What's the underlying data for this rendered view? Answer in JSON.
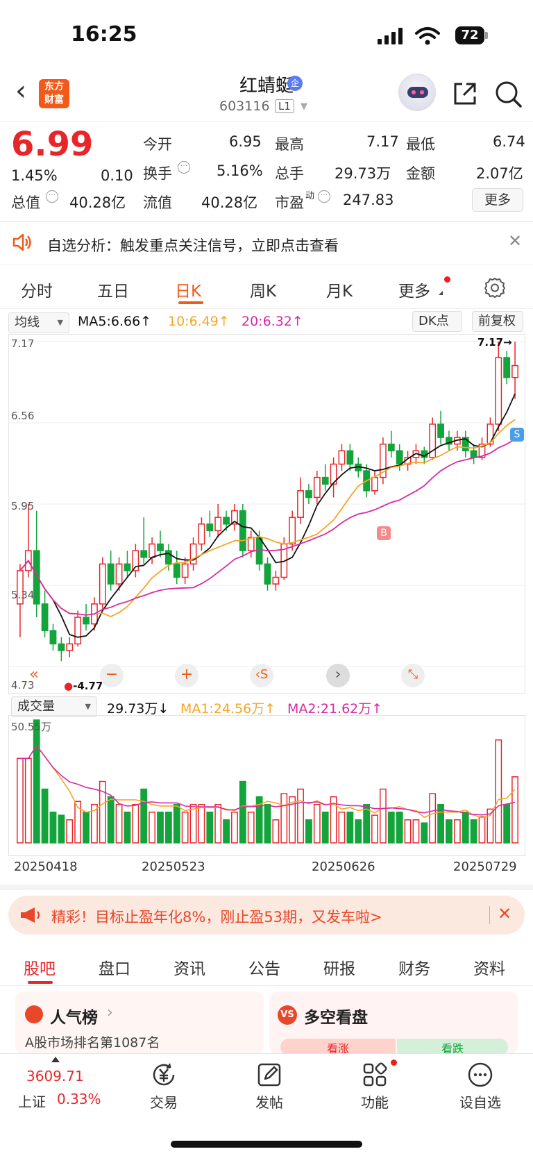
{
  "status": {
    "time": "16:25",
    "battery": "72"
  },
  "header": {
    "logo": "东方财富",
    "name": "红蜻蜓",
    "badge": "企",
    "code": "603116",
    "level": "L1"
  },
  "quote": {
    "price": "6.99",
    "change_pct": "1.45%",
    "change": "0.10",
    "open_label": "今开",
    "open": "6.95",
    "high_label": "最高",
    "high": "7.17",
    "low_label": "最低",
    "low": "6.74",
    "turnover_label": "换手",
    "turnover": "5.16%",
    "volume_label": "总手",
    "volume": "29.73万",
    "amount_label": "金额",
    "amount": "2.07亿",
    "mcap_label": "总值",
    "mcap": "40.28亿",
    "float_label": "流值",
    "float": "40.28亿",
    "pe_label": "市盈",
    "pe_sup": "动",
    "pe": "247.83",
    "more": "更多"
  },
  "alert": {
    "text": "自选分析：触发重点关注信号，立即点击查看"
  },
  "tabs": [
    "分时",
    "五日",
    "日K",
    "周K",
    "月K",
    "更多"
  ],
  "active_tab": "日K",
  "ma_bar": {
    "selector": "均线",
    "ma5": "MA5:6.66",
    "ma10": "10:6.49",
    "ma20": "20:6.32",
    "dk": "DK点",
    "fq": "前复权"
  },
  "vol_bar": {
    "selector": "成交量",
    "vol": "29.73万",
    "ma1": "MA1:24.56万",
    "ma2": "MA2:21.62万",
    "max_label": "50.55万"
  },
  "colors": {
    "up": "#e8262a",
    "down": "#13a43b",
    "ma5": "#111111",
    "ma10": "#f5a623",
    "ma20": "#d62aa6",
    "accent": "#f05a1a"
  },
  "chart_data": {
    "type": "candlestick",
    "y_ticks": [
      "7.17",
      "6.56",
      "5.95",
      "5.34",
      "4.73"
    ],
    "ylim": [
      4.73,
      7.17
    ],
    "max_label": "7.17",
    "min_label": "4.77",
    "x_ticks": [
      "20250418",
      "20250523",
      "20250626",
      "20250729"
    ],
    "markers": [
      "B",
      "S"
    ],
    "ohlc": [
      [
        5.2,
        5.5,
        4.95,
        5.45
      ],
      [
        5.45,
        5.95,
        5.4,
        5.6
      ],
      [
        5.6,
        5.9,
        5.1,
        5.2
      ],
      [
        5.2,
        5.3,
        4.95,
        5.0
      ],
      [
        5.0,
        5.05,
        4.85,
        4.9
      ],
      [
        4.9,
        4.95,
        4.77,
        4.85
      ],
      [
        4.85,
        4.95,
        4.8,
        4.9
      ],
      [
        4.9,
        5.15,
        4.88,
        5.1
      ],
      [
        5.1,
        5.2,
        5.0,
        5.05
      ],
      [
        5.05,
        5.25,
        5.0,
        5.2
      ],
      [
        5.2,
        5.55,
        5.15,
        5.5
      ],
      [
        5.5,
        5.6,
        5.3,
        5.35
      ],
      [
        5.35,
        5.55,
        5.3,
        5.5
      ],
      [
        5.5,
        5.6,
        5.4,
        5.45
      ],
      [
        5.45,
        5.65,
        5.4,
        5.6
      ],
      [
        5.6,
        5.85,
        5.5,
        5.55
      ],
      [
        5.55,
        5.7,
        5.5,
        5.65
      ],
      [
        5.65,
        5.75,
        5.55,
        5.6
      ],
      [
        5.6,
        5.65,
        5.45,
        5.5
      ],
      [
        5.5,
        5.6,
        5.35,
        5.4
      ],
      [
        5.4,
        5.55,
        5.35,
        5.5
      ],
      [
        5.5,
        5.7,
        5.45,
        5.65
      ],
      [
        5.65,
        5.85,
        5.6,
        5.8
      ],
      [
        5.8,
        5.9,
        5.7,
        5.75
      ],
      [
        5.75,
        5.95,
        5.7,
        5.85
      ],
      [
        5.85,
        5.9,
        5.75,
        5.8
      ],
      [
        5.8,
        5.95,
        5.75,
        5.9
      ],
      [
        5.9,
        5.95,
        5.55,
        5.6
      ],
      [
        5.6,
        5.75,
        5.55,
        5.7
      ],
      [
        5.7,
        5.75,
        5.45,
        5.5
      ],
      [
        5.5,
        5.55,
        5.3,
        5.35
      ],
      [
        5.35,
        5.45,
        5.3,
        5.4
      ],
      [
        5.4,
        5.7,
        5.38,
        5.65
      ],
      [
        5.65,
        5.9,
        5.6,
        5.85
      ],
      [
        5.85,
        6.15,
        5.8,
        6.05
      ],
      [
        6.05,
        6.1,
        5.95,
        6.0
      ],
      [
        6.0,
        6.2,
        5.95,
        6.15
      ],
      [
        6.15,
        6.25,
        6.05,
        6.1
      ],
      [
        6.1,
        6.3,
        6.0,
        6.25
      ],
      [
        6.25,
        6.4,
        6.2,
        6.35
      ],
      [
        6.35,
        6.4,
        6.2,
        6.25
      ],
      [
        6.25,
        6.3,
        6.15,
        6.2
      ],
      [
        6.2,
        6.25,
        6.0,
        6.05
      ],
      [
        6.05,
        6.2,
        6.02,
        6.15
      ],
      [
        6.15,
        6.45,
        6.1,
        6.4
      ],
      [
        6.4,
        6.5,
        6.3,
        6.35
      ],
      [
        6.35,
        6.4,
        6.2,
        6.25
      ],
      [
        6.25,
        6.35,
        6.2,
        6.3
      ],
      [
        6.3,
        6.4,
        6.25,
        6.35
      ],
      [
        6.35,
        6.38,
        6.25,
        6.3
      ],
      [
        6.3,
        6.6,
        6.28,
        6.55
      ],
      [
        6.55,
        6.65,
        6.4,
        6.45
      ],
      [
        6.45,
        6.5,
        6.35,
        6.4
      ],
      [
        6.4,
        6.5,
        6.35,
        6.45
      ],
      [
        6.45,
        6.5,
        6.3,
        6.35
      ],
      [
        6.35,
        6.4,
        6.25,
        6.3
      ],
      [
        6.3,
        6.45,
        6.28,
        6.4
      ],
      [
        6.4,
        6.6,
        6.38,
        6.55
      ],
      [
        6.55,
        7.17,
        6.5,
        7.05
      ],
      [
        7.05,
        7.1,
        6.85,
        6.9
      ],
      [
        6.9,
        7.17,
        6.74,
        6.99
      ]
    ]
  },
  "banner": {
    "text": "精彩！目标止盈年化8%，刚止盈53期，又发车啦>"
  },
  "subtabs": [
    "股吧",
    "盘口",
    "资讯",
    "公告",
    "研报",
    "财务",
    "资料"
  ],
  "cards": {
    "hot_title": "人气榜",
    "hot_sub": "A股市场排名第1087名",
    "vs_title": "多空看盘",
    "vs_up": "看涨",
    "vs_down": "看跌"
  },
  "bottom_nav": {
    "index_value": "3609.71",
    "index_name": "上证",
    "index_change": "0.33%",
    "trade": "交易",
    "post": "发帖",
    "func": "功能",
    "watch": "设自选"
  }
}
